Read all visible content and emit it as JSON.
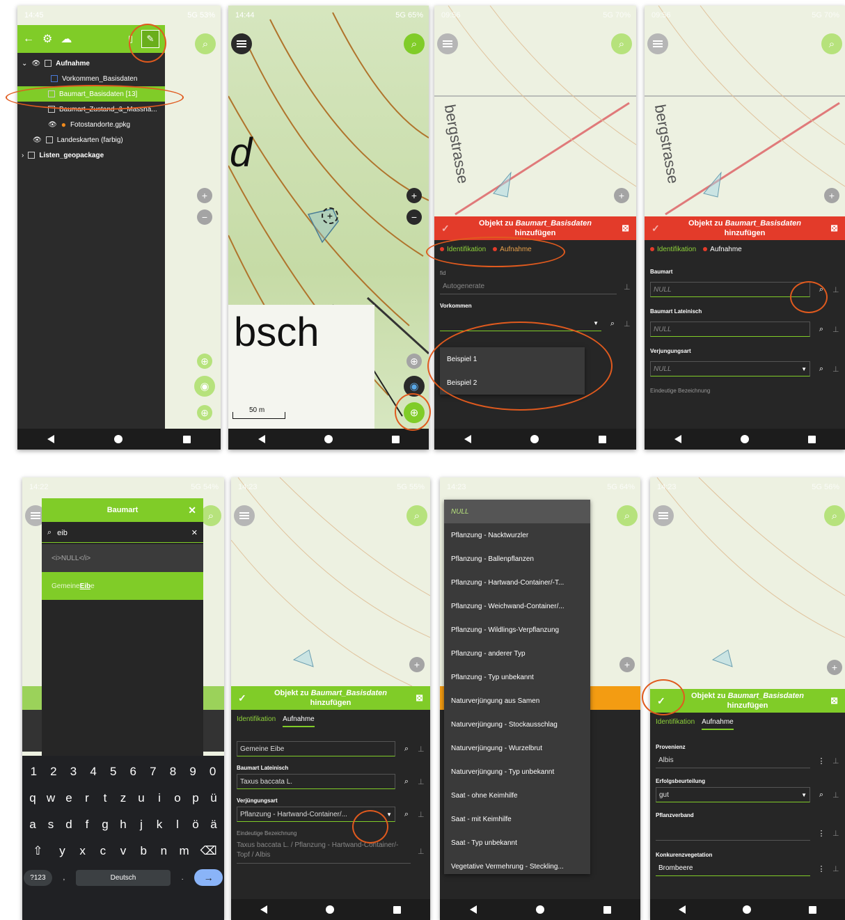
{
  "screen1": {
    "status_time": "14:45",
    "status_right": "5G 53%",
    "panel_rows": [
      {
        "label": "Aufnahme"
      },
      {
        "label": "Vorkommen_Basisdaten"
      },
      {
        "label": "Baumart_Basisdaten [13]"
      },
      {
        "label": "Baumart_Zustand_&_Massna..."
      },
      {
        "label": "Fotostandorte.gpkg"
      },
      {
        "label": "Landeskarten (farbig)"
      },
      {
        "label": "Listen_geopackage"
      }
    ]
  },
  "screen2": {
    "status_time": "14:44",
    "status_right": "5G 65%",
    "map_label_1": "d",
    "map_label_2": "bsch",
    "scale_label": "50 m"
  },
  "screen3": {
    "status_time": "09:56",
    "status_right": "5G 70%",
    "street_label": "bergstrasse",
    "title_line1": "Objekt zu ",
    "title_layer": "Baumart_Basisdaten",
    "title_line2": "hinzufügen",
    "tab_identification": "Identifikation",
    "tab_aufnahme": "Aufnahme",
    "field_fid_label": "fid",
    "field_fid_value": "Autogenerate",
    "field_vorkommen_label": "Vorkommen",
    "dropdown_items": [
      "Beispiel 1",
      "Beispiel 2"
    ]
  },
  "screen4": {
    "status_time": "09:56",
    "status_right": "5G 70%",
    "street_label": "bergstrasse",
    "title_line1": "Objekt zu ",
    "title_layer": "Baumart_Basisdaten",
    "title_line2": "hinzufügen",
    "tab_identification": "Identifikation",
    "tab_aufnahme": "Aufnahme",
    "fields": [
      {
        "label": "Baumart",
        "value": "NULL"
      },
      {
        "label": "Baumart Lateinisch",
        "value": "NULL"
      },
      {
        "label": "Verjungungsart",
        "value": "NULL"
      },
      {
        "label": "Eindeutige Bezeichnung",
        "value": ""
      }
    ]
  },
  "screen5": {
    "status_time": "14:22",
    "status_right": "5G 54%",
    "search_title": "Baumart",
    "search_value": "eib",
    "result_null": "<i>NULL</i>",
    "result_match_prefix": "Gemeine ",
    "result_match_bold": "Eib",
    "result_match_suffix": "e",
    "kb_row1": [
      "1",
      "2",
      "3",
      "4",
      "5",
      "6",
      "7",
      "8",
      "9",
      "0"
    ],
    "kb_row2": [
      "q",
      "w",
      "e",
      "r",
      "t",
      "z",
      "u",
      "i",
      "o",
      "p",
      "ü"
    ],
    "kb_row3": [
      "a",
      "s",
      "d",
      "f",
      "g",
      "h",
      "j",
      "k",
      "l",
      "ö",
      "ä"
    ],
    "kb_row4": [
      "y",
      "x",
      "c",
      "v",
      "b",
      "n",
      "m"
    ],
    "kb_sym": "?123",
    "kb_comma": ",",
    "kb_lang": "Deutsch",
    "kb_dot": "."
  },
  "screen6": {
    "status_time": "14:23",
    "status_right": "5G 55%",
    "title_line1": "Objekt zu ",
    "title_layer": "Baumart_Basisdaten",
    "title_line2": "hinzufügen",
    "tab_identification": "Identifikation",
    "tab_aufnahme": "Aufnahme",
    "field1_value": "Gemeine Eibe",
    "field2_label": "Baumart Lateinisch",
    "field2_value": "Taxus baccata L.",
    "field3_label": "Verjüngungsart",
    "field3_value": "Pflanzung - Hartwand-Container/...",
    "field4_label": "Eindeutige Bezeichnung",
    "field4_value": "Taxus baccata L. / Pflanzung - Hartwand-Container/-Topf / Albis"
  },
  "screen7": {
    "status_time": "14:23",
    "status_right": "5G 64%",
    "options": [
      "NULL",
      "Pflanzung - Nacktwurzler",
      "Pflanzung - Ballenpflanzen",
      "Pflanzung - Hartwand-Container/-T...",
      "Pflanzung - Weichwand-Container/...",
      "Pflanzung - Wildlings-Verpflanzung",
      "Pflanzung - anderer Typ",
      "Pflanzung - Typ unbekannt",
      "Naturverjüngung aus Samen",
      "Naturverjüngung - Stockausschlag",
      "Naturverjüngung - Wurzelbrut",
      "Naturverjüngung - Typ unbekannt",
      "Saat - ohne Keimhilfe",
      "Saat - mit Keimhilfe",
      "Saat - Typ unbekannt",
      "Vegetative Vermehrung - Steckling..."
    ]
  },
  "screen8": {
    "status_time": "14:23",
    "status_right": "5G 56%",
    "title_line1": "Objekt zu ",
    "title_layer": "Baumart_Basisdaten",
    "title_line2": "hinzufügen",
    "tab_identification": "Identifikation",
    "tab_aufnahme": "Aufnahme",
    "fields": [
      {
        "label": "Provenienz",
        "value": "Albis"
      },
      {
        "label": "Erfolgsbeurteilung",
        "value": "gut"
      },
      {
        "label": "Pflanzverband",
        "value": ""
      },
      {
        "label": "Konkurenzvegetation",
        "value": "Brombeere"
      }
    ]
  },
  "colors": {
    "accent_green": "#80cc28",
    "form_red": "#e33b2a",
    "form_orange": "#f39c12",
    "highlight_ring": "#e05a1e",
    "panel_dark": "#262626"
  }
}
